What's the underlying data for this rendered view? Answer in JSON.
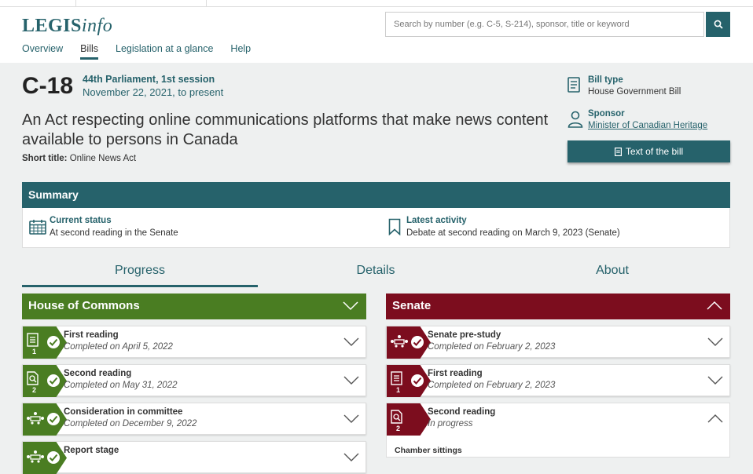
{
  "header": {
    "logo_bold": "LEGIS",
    "logo_italic": "info",
    "search_placeholder": "Search by number (e.g. C-5, S-214), sponsor, title or keyword",
    "nav": [
      "Overview",
      "Bills",
      "Legislation at a glance",
      "Help"
    ],
    "active_nav": "Bills"
  },
  "bill": {
    "number": "C-18",
    "parliament": "44th Parliament, 1st session",
    "dates": "November 22, 2021, to present",
    "title": "An Act respecting online communications platforms that make news content available to persons in Canada",
    "short_title_label": "Short title:",
    "short_title": "Online News Act",
    "type_label": "Bill type",
    "type_value": "House Government Bill",
    "sponsor_label": "Sponsor",
    "sponsor_value": "Minister of Canadian Heritage",
    "text_button": "Text of the bill"
  },
  "summary": {
    "heading": "Summary",
    "status_label": "Current status",
    "status_value": "At second reading in the Senate",
    "activity_label": "Latest activity",
    "activity_value": "Debate at second reading on March 9, 2023 (Senate)"
  },
  "tabs": [
    "Progress",
    "Details",
    "About"
  ],
  "active_tab": "Progress",
  "house": {
    "heading": "House of Commons",
    "color": "#4a7d22",
    "stages": [
      {
        "name": "First reading",
        "status": "Completed on April 5, 2022",
        "num": "1",
        "icon": "document-icon"
      },
      {
        "name": "Second reading",
        "status": "Completed on May 31, 2022",
        "num": "2",
        "icon": "document-search-icon"
      },
      {
        "name": "Consideration in committee",
        "status": "Completed on December 9, 2022",
        "num": "",
        "icon": "committee-icon"
      },
      {
        "name": "Report stage",
        "status": "",
        "num": "",
        "icon": "committee-icon"
      }
    ]
  },
  "senate": {
    "heading": "Senate",
    "color": "#7c0d1e",
    "stages": [
      {
        "name": "Senate pre-study",
        "status": "Completed on February 2, 2023",
        "num": "",
        "icon": "committee-icon"
      },
      {
        "name": "First reading",
        "status": "Completed on February 2, 2023",
        "num": "1",
        "icon": "document-icon"
      },
      {
        "name": "Second reading",
        "status": "In progress",
        "num": "2",
        "icon": "document-search-icon"
      }
    ],
    "chamber_sittings": "Chamber sittings"
  }
}
